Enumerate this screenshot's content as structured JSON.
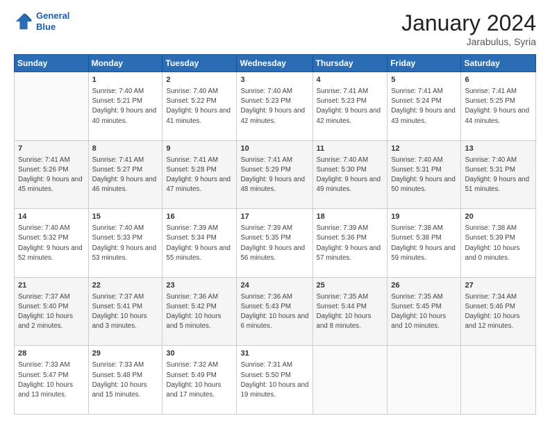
{
  "header": {
    "logo_line1": "General",
    "logo_line2": "Blue",
    "month_title": "January 2024",
    "location": "Jarabulus, Syria"
  },
  "weekdays": [
    "Sunday",
    "Monday",
    "Tuesday",
    "Wednesday",
    "Thursday",
    "Friday",
    "Saturday"
  ],
  "weeks": [
    [
      {
        "day": "",
        "sunrise": "",
        "sunset": "",
        "daylight": ""
      },
      {
        "day": "1",
        "sunrise": "Sunrise: 7:40 AM",
        "sunset": "Sunset: 5:21 PM",
        "daylight": "Daylight: 9 hours and 40 minutes."
      },
      {
        "day": "2",
        "sunrise": "Sunrise: 7:40 AM",
        "sunset": "Sunset: 5:22 PM",
        "daylight": "Daylight: 9 hours and 41 minutes."
      },
      {
        "day": "3",
        "sunrise": "Sunrise: 7:40 AM",
        "sunset": "Sunset: 5:23 PM",
        "daylight": "Daylight: 9 hours and 42 minutes."
      },
      {
        "day": "4",
        "sunrise": "Sunrise: 7:41 AM",
        "sunset": "Sunset: 5:23 PM",
        "daylight": "Daylight: 9 hours and 42 minutes."
      },
      {
        "day": "5",
        "sunrise": "Sunrise: 7:41 AM",
        "sunset": "Sunset: 5:24 PM",
        "daylight": "Daylight: 9 hours and 43 minutes."
      },
      {
        "day": "6",
        "sunrise": "Sunrise: 7:41 AM",
        "sunset": "Sunset: 5:25 PM",
        "daylight": "Daylight: 9 hours and 44 minutes."
      }
    ],
    [
      {
        "day": "7",
        "sunrise": "Sunrise: 7:41 AM",
        "sunset": "Sunset: 5:26 PM",
        "daylight": "Daylight: 9 hours and 45 minutes."
      },
      {
        "day": "8",
        "sunrise": "Sunrise: 7:41 AM",
        "sunset": "Sunset: 5:27 PM",
        "daylight": "Daylight: 9 hours and 46 minutes."
      },
      {
        "day": "9",
        "sunrise": "Sunrise: 7:41 AM",
        "sunset": "Sunset: 5:28 PM",
        "daylight": "Daylight: 9 hours and 47 minutes."
      },
      {
        "day": "10",
        "sunrise": "Sunrise: 7:41 AM",
        "sunset": "Sunset: 5:29 PM",
        "daylight": "Daylight: 9 hours and 48 minutes."
      },
      {
        "day": "11",
        "sunrise": "Sunrise: 7:40 AM",
        "sunset": "Sunset: 5:30 PM",
        "daylight": "Daylight: 9 hours and 49 minutes."
      },
      {
        "day": "12",
        "sunrise": "Sunrise: 7:40 AM",
        "sunset": "Sunset: 5:31 PM",
        "daylight": "Daylight: 9 hours and 50 minutes."
      },
      {
        "day": "13",
        "sunrise": "Sunrise: 7:40 AM",
        "sunset": "Sunset: 5:31 PM",
        "daylight": "Daylight: 9 hours and 51 minutes."
      }
    ],
    [
      {
        "day": "14",
        "sunrise": "Sunrise: 7:40 AM",
        "sunset": "Sunset: 5:32 PM",
        "daylight": "Daylight: 9 hours and 52 minutes."
      },
      {
        "day": "15",
        "sunrise": "Sunrise: 7:40 AM",
        "sunset": "Sunset: 5:33 PM",
        "daylight": "Daylight: 9 hours and 53 minutes."
      },
      {
        "day": "16",
        "sunrise": "Sunrise: 7:39 AM",
        "sunset": "Sunset: 5:34 PM",
        "daylight": "Daylight: 9 hours and 55 minutes."
      },
      {
        "day": "17",
        "sunrise": "Sunrise: 7:39 AM",
        "sunset": "Sunset: 5:35 PM",
        "daylight": "Daylight: 9 hours and 56 minutes."
      },
      {
        "day": "18",
        "sunrise": "Sunrise: 7:39 AM",
        "sunset": "Sunset: 5:36 PM",
        "daylight": "Daylight: 9 hours and 57 minutes."
      },
      {
        "day": "19",
        "sunrise": "Sunrise: 7:38 AM",
        "sunset": "Sunset: 5:38 PM",
        "daylight": "Daylight: 9 hours and 59 minutes."
      },
      {
        "day": "20",
        "sunrise": "Sunrise: 7:38 AM",
        "sunset": "Sunset: 5:39 PM",
        "daylight": "Daylight: 10 hours and 0 minutes."
      }
    ],
    [
      {
        "day": "21",
        "sunrise": "Sunrise: 7:37 AM",
        "sunset": "Sunset: 5:40 PM",
        "daylight": "Daylight: 10 hours and 2 minutes."
      },
      {
        "day": "22",
        "sunrise": "Sunrise: 7:37 AM",
        "sunset": "Sunset: 5:41 PM",
        "daylight": "Daylight: 10 hours and 3 minutes."
      },
      {
        "day": "23",
        "sunrise": "Sunrise: 7:36 AM",
        "sunset": "Sunset: 5:42 PM",
        "daylight": "Daylight: 10 hours and 5 minutes."
      },
      {
        "day": "24",
        "sunrise": "Sunrise: 7:36 AM",
        "sunset": "Sunset: 5:43 PM",
        "daylight": "Daylight: 10 hours and 6 minutes."
      },
      {
        "day": "25",
        "sunrise": "Sunrise: 7:35 AM",
        "sunset": "Sunset: 5:44 PM",
        "daylight": "Daylight: 10 hours and 8 minutes."
      },
      {
        "day": "26",
        "sunrise": "Sunrise: 7:35 AM",
        "sunset": "Sunset: 5:45 PM",
        "daylight": "Daylight: 10 hours and 10 minutes."
      },
      {
        "day": "27",
        "sunrise": "Sunrise: 7:34 AM",
        "sunset": "Sunset: 5:46 PM",
        "daylight": "Daylight: 10 hours and 12 minutes."
      }
    ],
    [
      {
        "day": "28",
        "sunrise": "Sunrise: 7:33 AM",
        "sunset": "Sunset: 5:47 PM",
        "daylight": "Daylight: 10 hours and 13 minutes."
      },
      {
        "day": "29",
        "sunrise": "Sunrise: 7:33 AM",
        "sunset": "Sunset: 5:48 PM",
        "daylight": "Daylight: 10 hours and 15 minutes."
      },
      {
        "day": "30",
        "sunrise": "Sunrise: 7:32 AM",
        "sunset": "Sunset: 5:49 PM",
        "daylight": "Daylight: 10 hours and 17 minutes."
      },
      {
        "day": "31",
        "sunrise": "Sunrise: 7:31 AM",
        "sunset": "Sunset: 5:50 PM",
        "daylight": "Daylight: 10 hours and 19 minutes."
      },
      {
        "day": "",
        "sunrise": "",
        "sunset": "",
        "daylight": ""
      },
      {
        "day": "",
        "sunrise": "",
        "sunset": "",
        "daylight": ""
      },
      {
        "day": "",
        "sunrise": "",
        "sunset": "",
        "daylight": ""
      }
    ]
  ]
}
